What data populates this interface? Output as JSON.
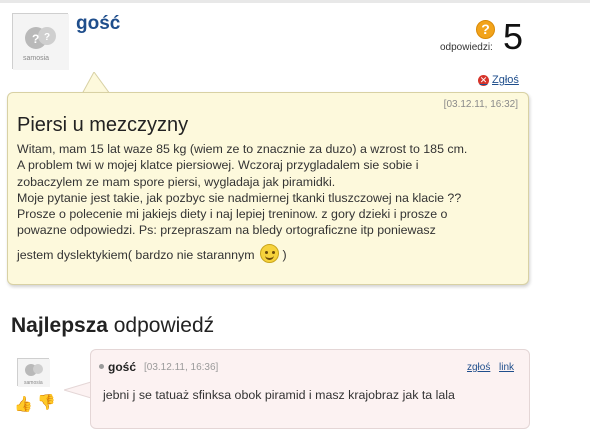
{
  "question": {
    "author": "gość",
    "avatar_text": "samosia",
    "answers_label": "odpowiedzi:",
    "answers_count": "5",
    "report_label": "Zgłoś",
    "date": "[03.12.11, 16:32]",
    "title": "Piersi u mezczyzny",
    "body_lines": [
      "Witam, mam 15 lat waze 85 kg (wiem ze to znacznie za duzo) a wzrost to 185 cm.",
      "A problem twi w mojej klatce piersiowej. Wczoraj przygladalem sie sobie i",
      "zobaczylem ze mam spore piersi, wygladaja jak piramidki.",
      "Moje pytanie jest takie, jak pozbyc sie nadmiernej tkanki tluszczowej na klacie ??",
      "Prosze o polecenie mi jakiejs diety i naj lepiej treninow. z gory dzieki i prosze o",
      "powazne odpowiedzi. Ps: przepraszam na bledy ortograficzne itp poniewasz",
      "jestem dyslektykiem( bardzo nie starannym"
    ],
    "body_tail": ")"
  },
  "best_answer": {
    "heading_bold": "Najlepsza",
    "heading_rest": " odpowiedź",
    "author": "gość",
    "avatar_text": "samosia",
    "date": "[03.12.11, 16:36]",
    "report_label": "zgłoś",
    "link_label": "link",
    "text": "jebni j se tatuaż sfinksa obok piramid i masz krajobraz jak ta lala"
  },
  "colors": {
    "author_blue": "#1f4e8c",
    "bubble_yellow": "#fdf9dc",
    "answer_pink": "#fcf2f2",
    "badge_orange": "#f2a31a"
  }
}
